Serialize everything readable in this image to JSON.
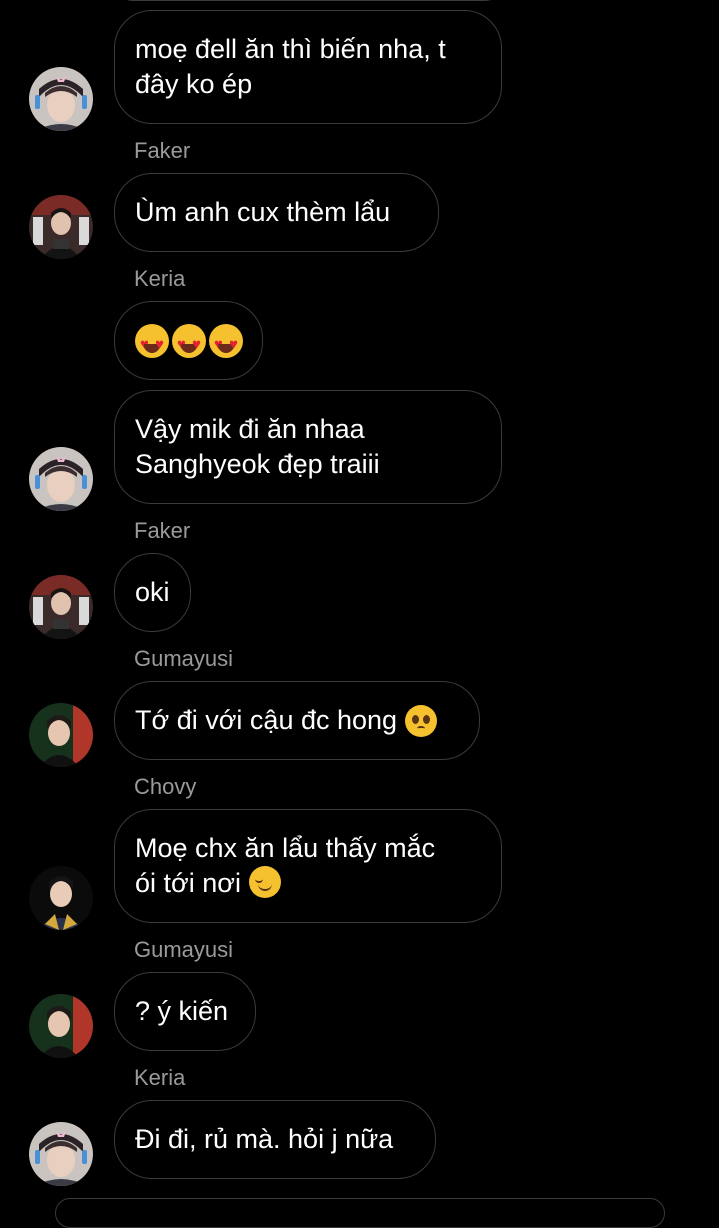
{
  "messages": [
    {
      "sender": "",
      "text": "moẹ đell ăn thì biến nha, t\nđây ko ép",
      "avatar": "keria-avatar"
    },
    {
      "sender": "Faker",
      "text": "Ùm anh cux thèm lẩu",
      "avatar": "faker-avatar"
    },
    {
      "sender": "Keria",
      "text": "",
      "emoji": [
        "heart-eyes",
        "heart-eyes",
        "heart-eyes"
      ],
      "avatar": ""
    },
    {
      "sender": "",
      "text": "Vậy mik đi ăn nhaa\nSanghyeok đẹp traiii",
      "avatar": "keria-avatar"
    },
    {
      "sender": "Faker",
      "text": "oki",
      "avatar": "faker-avatar"
    },
    {
      "sender": "Gumayusi",
      "text": "Tớ đi với cậu đc hong",
      "trailing_emoji": "pleading-face",
      "avatar": "gumayusi-avatar"
    },
    {
      "sender": "Chovy",
      "text": "Moẹ chx ăn lẩu thấy mắc\nói tới nơi",
      "trailing_emoji": "smiling-face",
      "avatar": "chovy-avatar"
    },
    {
      "sender": "Gumayusi",
      "text": "? ý kiến",
      "avatar": "gumayusi-avatar"
    },
    {
      "sender": "Keria",
      "text": "Đi đi, rủ mà. hỏi j nữa",
      "avatar": "keria-avatar"
    }
  ],
  "colors": {
    "background": "#000000",
    "bubble_border": "#3a3a3a",
    "sender_text": "#9a9a9a",
    "message_text": "#ffffff"
  }
}
